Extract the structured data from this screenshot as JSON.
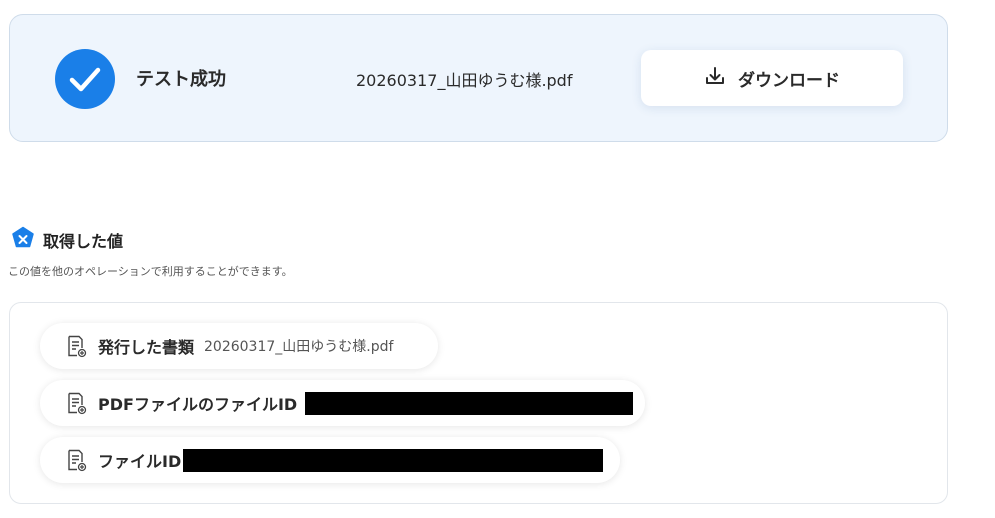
{
  "result": {
    "status": "テスト成功",
    "file_name": "20260317_山田ゆうむ様.pdf",
    "download_label": "ダウンロード"
  },
  "values_section": {
    "title": "取得した値",
    "description": "この値を他のオペレーションで利用することができます。",
    "items": [
      {
        "label": "発行した書類",
        "value": "20260317_山田ゆうむ様.pdf"
      },
      {
        "label": "PDFファイルのファイルID",
        "value": ""
      },
      {
        "label": "ファイルID",
        "value": ""
      }
    ]
  },
  "colors": {
    "accent": "#1a7fe8",
    "card_background": "#eef5fd"
  },
  "icons": [
    "check-icon",
    "download-icon",
    "variable-badge-icon",
    "document-icon"
  ]
}
